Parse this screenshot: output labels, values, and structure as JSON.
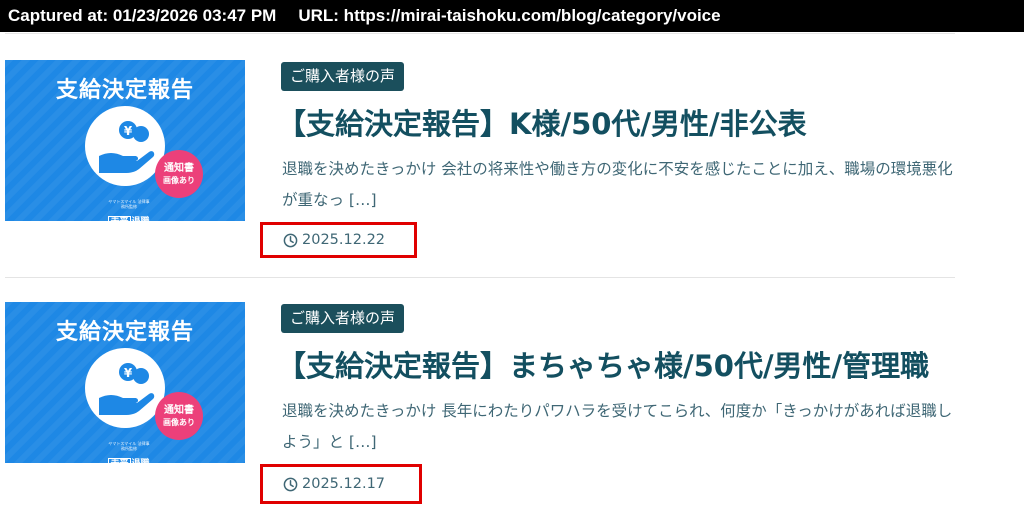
{
  "capture": {
    "captured_at": "Captured at: 01/23/2026 03:47 PM",
    "url": "URL: https://mirai-taishoku.com/blog/category/voice"
  },
  "posts": [
    {
      "thumbnail": {
        "title": "支給決定報告",
        "badge_line1": "通知書",
        "badge_line2": "画像あり",
        "logo_small": "ヤマトスマイル 法律事務所監修",
        "logo_boxed": "未来",
        "logo_word": "退職",
        "icon": "hand-coin-icon"
      },
      "category": "ご購入者様の声",
      "title": "【支給決定報告】K様/50代/男性/非公表",
      "excerpt": "退職を決めたきっかけ 会社の将来性や働き方の変化に不安を感じたことに加え、職場の環境悪化が重なっ […]",
      "date": "2025.12.22"
    },
    {
      "thumbnail": {
        "title": "支給決定報告",
        "badge_line1": "通知書",
        "badge_line2": "画像あり",
        "logo_small": "ヤマトスマイル 法律事務所監修",
        "logo_boxed": "未来",
        "logo_word": "退職",
        "icon": "hand-coin-icon"
      },
      "category": "ご購入者様の声",
      "title": "【支給決定報告】まちゃちゃ様/50代/男性/管理職",
      "excerpt": "退職を決めたきっかけ 長年にわたりパワハラを受けてこられ、何度か「きっかけがあれば退職しよう」と […]",
      "date": "2025.12.17"
    }
  ],
  "colors": {
    "thumbnail_blue": "#1e88e5",
    "badge_pink": "#ec407a",
    "category_bg": "#1b4f5c",
    "title_text": "#134f60",
    "highlight_red": "#e00000"
  }
}
